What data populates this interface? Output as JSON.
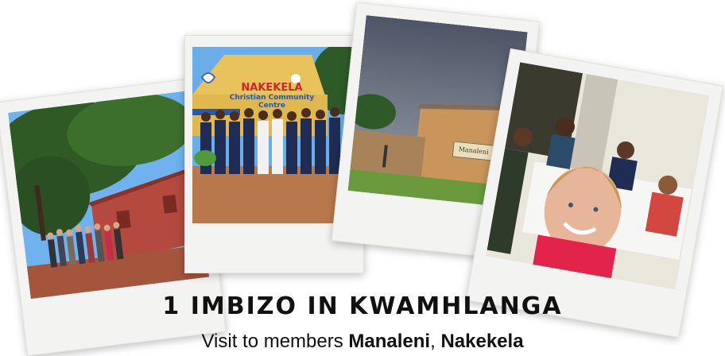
{
  "title": "1 IMBIZO IN KWAMHLANGA",
  "subtitle": {
    "prefix": "Visit to members ",
    "member1": "Manaleni",
    "separator": ", ",
    "member2": "Nakekela"
  },
  "photos": {
    "nakekela_sign": {
      "line1": "NAKEKELA",
      "line2": "Christian Community Centre"
    },
    "manaleni_sign": "Manaleni"
  },
  "colors": {
    "sky_blue": "#5aa6e6",
    "brick_red": "#b4493f",
    "building_tan": "#c9955a",
    "nakekela_yellow": "#e8c25a",
    "polaroid_frame": "#f3f3f1"
  }
}
